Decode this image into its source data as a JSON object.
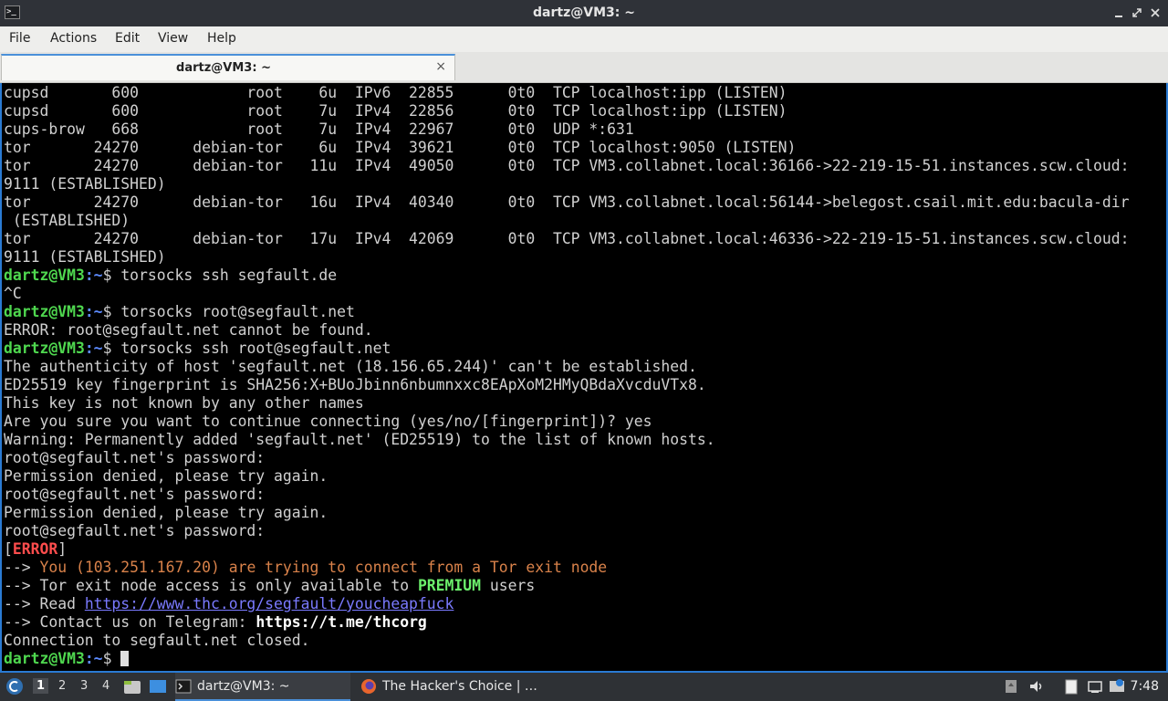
{
  "window": {
    "title": "dartz@VM3: ~",
    "app_icon": ">_"
  },
  "menu": [
    "File",
    "Actions",
    "Edit",
    "View",
    "Help"
  ],
  "tab": {
    "label": "dartz@VM3: ~",
    "close": "×"
  },
  "terminal": {
    "prompt_user": "dartz@VM3",
    "prompt_path": ":~",
    "prompt_sign": "$ ",
    "lines": [
      {
        "type": "text",
        "text": "cupsd       600            root    6u  IPv6  22855      0t0  TCP localhost:ipp (LISTEN)"
      },
      {
        "type": "text",
        "text": "cupsd       600            root    7u  IPv4  22856      0t0  TCP localhost:ipp (LISTEN)"
      },
      {
        "type": "text",
        "text": "cups-brow   668            root    7u  IPv4  22967      0t0  UDP *:631"
      },
      {
        "type": "text",
        "text": "tor       24270      debian-tor    6u  IPv4  39621      0t0  TCP localhost:9050 (LISTEN)"
      },
      {
        "type": "text",
        "text": "tor       24270      debian-tor   11u  IPv4  49050      0t0  TCP VM3.collabnet.local:36166->22-219-15-51.instances.scw.cloud:"
      },
      {
        "type": "text",
        "text": "9111 (ESTABLISHED)"
      },
      {
        "type": "text",
        "text": "tor       24270      debian-tor   16u  IPv4  40340      0t0  TCP VM3.collabnet.local:56144->belegost.csail.mit.edu:bacula-dir"
      },
      {
        "type": "text",
        "text": " (ESTABLISHED)"
      },
      {
        "type": "text",
        "text": "tor       24270      debian-tor   17u  IPv4  42069      0t0  TCP VM3.collabnet.local:46336->22-219-15-51.instances.scw.cloud:"
      },
      {
        "type": "text",
        "text": "9111 (ESTABLISHED)"
      },
      {
        "type": "prompt",
        "cmd": "torsocks ssh segfault.de"
      },
      {
        "type": "text",
        "text": "^C"
      },
      {
        "type": "prompt",
        "cmd": "torsocks root@segfault.net"
      },
      {
        "type": "text",
        "text": "ERROR: root@segfault.net cannot be found."
      },
      {
        "type": "prompt",
        "cmd": "torsocks ssh root@segfault.net"
      },
      {
        "type": "text",
        "text": "The authenticity of host 'segfault.net (18.156.65.244)' can't be established."
      },
      {
        "type": "text",
        "text": "ED25519 key fingerprint is SHA256:X+BUoJbinn6nbumnxxc8EApXoM2HMyQBdaXvcduVTx8."
      },
      {
        "type": "text",
        "text": "This key is not known by any other names"
      },
      {
        "type": "text",
        "text": "Are you sure you want to continue connecting (yes/no/[fingerprint])? yes"
      },
      {
        "type": "text",
        "text": "Warning: Permanently added 'segfault.net' (ED25519) to the list of known hosts."
      },
      {
        "type": "text",
        "text": "root@segfault.net's password:"
      },
      {
        "type": "text",
        "text": "Permission denied, please try again."
      },
      {
        "type": "text",
        "text": "root@segfault.net's password:"
      },
      {
        "type": "text",
        "text": "Permission denied, please try again."
      },
      {
        "type": "text",
        "text": "root@segfault.net's password:"
      },
      {
        "type": "error",
        "pre": "[",
        "word": "ERROR",
        "post": "]"
      },
      {
        "type": "orange",
        "pre": "--> ",
        "text": "You (103.251.167.20) are trying to connect from a Tor exit node"
      },
      {
        "type": "premium",
        "pre": "--> Tor exit node access is only available to ",
        "hl": "PREMIUM",
        "post": " users"
      },
      {
        "type": "link",
        "pre": "--> Read ",
        "link": "https://www.thc.org/segfault/youcheapfuck"
      },
      {
        "type": "bold",
        "pre": "--> Contact us on Telegram: ",
        "bold": "https://t.me/thcorg"
      },
      {
        "type": "text",
        "text": "Connection to segfault.net closed."
      },
      {
        "type": "prompt",
        "cmd": "",
        "cursor": true
      }
    ]
  },
  "taskbar": {
    "workspaces": [
      "1",
      "2",
      "3",
      "4"
    ],
    "active_workspace": "1",
    "tasks": [
      {
        "label": "dartz@VM3: ~",
        "icon": "terminal-icon"
      },
      {
        "label": "The Hacker's Choice | …",
        "icon": "firefox-icon"
      }
    ],
    "clock": "7:48"
  },
  "colors": {
    "prompt_user": "#4fd84f",
    "prompt_path": "#5d8bff",
    "error": "#ff4d4d",
    "warning": "#d9824a",
    "premium": "#6cf06c",
    "link": "#7a7aff",
    "focus_border": "#2a7bd3"
  }
}
